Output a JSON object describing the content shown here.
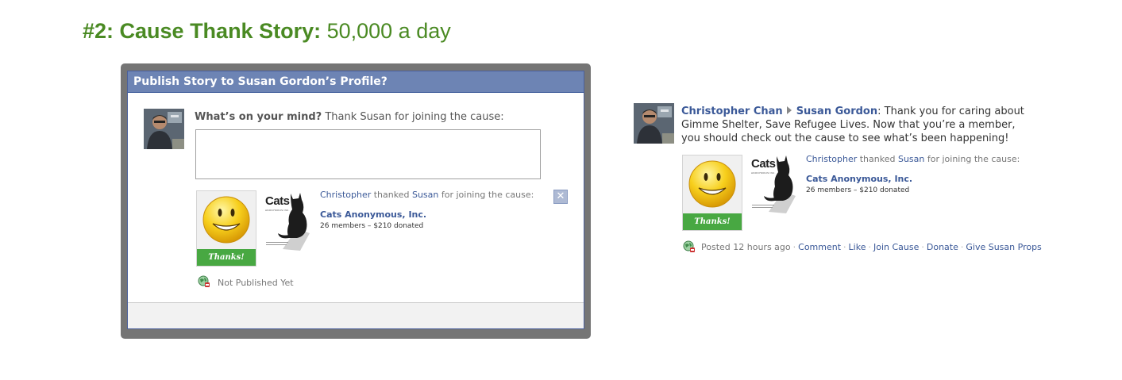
{
  "slide": {
    "title_bold": "#2: Cause Thank Story:",
    "title_rest": " 50,000 a day"
  },
  "dialog": {
    "title": "Publish Story to Susan Gordon’s Profile?",
    "prompt_question": "What’s on your mind?",
    "prompt_text": " Thank Susan for joining the cause:",
    "message_value": "",
    "attachment": {
      "actor": "Christopher",
      "verb": " thanked ",
      "target": "Susan",
      "rest": " for joining the cause:",
      "cause_name": "Cats Anonymous, Inc.",
      "cause_stats": "26 members – $210 donated",
      "thanks_label": "Thanks!"
    },
    "close_label": "✕",
    "status": "Not Published Yet"
  },
  "logo": {
    "word": "Cats",
    "sub": "ANONYMOUS INC."
  },
  "feed": {
    "actor": "Christopher Chan",
    "target": "Susan Gordon",
    "colon": ":",
    "message": " Thank you for caring about Gimme Shelter, Save Refugee Lives. Now that you’re a member, you should check out the cause to see what’s been happening!",
    "attachment": {
      "actor": "Christopher",
      "verb": " thanked ",
      "target": "Susan",
      "rest": " for joining the cause:",
      "cause_name": "Cats Anonymous, Inc.",
      "cause_stats": "26 members – $210 donated",
      "thanks_label": "Thanks!"
    },
    "posted": "Posted 12 hours ago",
    "actions": {
      "comment": "Comment",
      "like": "Like",
      "join": "Join Cause",
      "donate": "Donate",
      "props": "Give Susan Props"
    },
    "separator": "·"
  },
  "colors": {
    "title_green": "#4a8a23",
    "fb_blue": "#3b5998",
    "header_blue": "#6d84b4",
    "thanks_green": "#48a842"
  },
  "icons": {
    "avatar": "user-photo",
    "smiley": "smiley-face-icon",
    "globe": "globe-privacy-icon",
    "arrow": "triangle-right-icon",
    "close": "close-icon"
  }
}
